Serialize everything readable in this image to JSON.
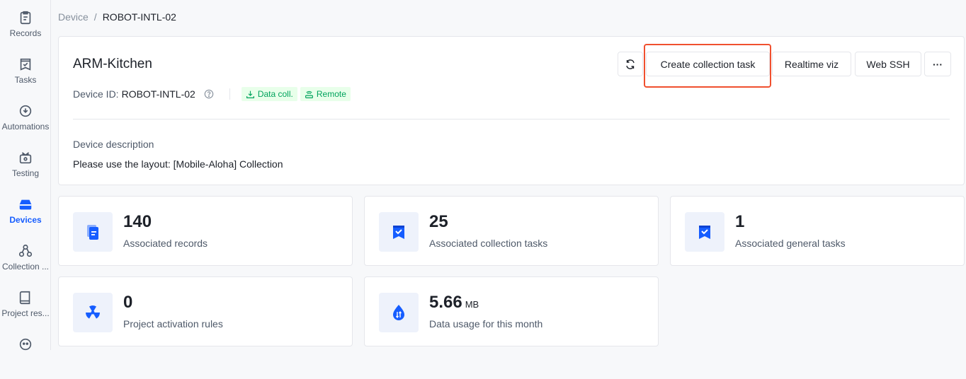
{
  "sidebar": {
    "items": [
      {
        "label": "Records",
        "icon": "clipboard-icon",
        "active": false
      },
      {
        "label": "Tasks",
        "icon": "task-check-icon",
        "active": false
      },
      {
        "label": "Automations",
        "icon": "automation-icon",
        "active": false
      },
      {
        "label": "Testing",
        "icon": "testing-icon",
        "active": false
      },
      {
        "label": "Devices",
        "icon": "devices-icon",
        "active": true
      },
      {
        "label": "Collection ...",
        "icon": "collection-icon",
        "active": false
      },
      {
        "label": "Project res...",
        "icon": "book-icon",
        "active": false
      }
    ]
  },
  "breadcrumb": {
    "root": "Device",
    "separator": "/",
    "current": "ROBOT-INTL-02"
  },
  "device": {
    "title": "ARM-Kitchen",
    "id_label": "Device ID:",
    "id_value": "ROBOT-INTL-02",
    "tags": [
      "Data coll.",
      "Remote"
    ],
    "description_label": "Device description",
    "description": "Please use the layout: [Mobile-Aloha] Collection"
  },
  "toolbar": {
    "create_task": "Create collection task",
    "realtime_viz": "Realtime viz",
    "web_ssh": "Web SSH",
    "more": "···"
  },
  "stats": [
    {
      "value": "140",
      "unit": "",
      "label": "Associated records"
    },
    {
      "value": "25",
      "unit": "",
      "label": "Associated collection tasks"
    },
    {
      "value": "1",
      "unit": "",
      "label": "Associated general tasks"
    },
    {
      "value": "0",
      "unit": "",
      "label": "Project activation rules"
    },
    {
      "value": "5.66",
      "unit": "MB",
      "label": "Data usage for this month"
    }
  ],
  "colors": {
    "accent": "#165dff",
    "tag_bg": "#e8ffea",
    "tag_fg": "#00a35c",
    "highlight": "#f0502f"
  }
}
